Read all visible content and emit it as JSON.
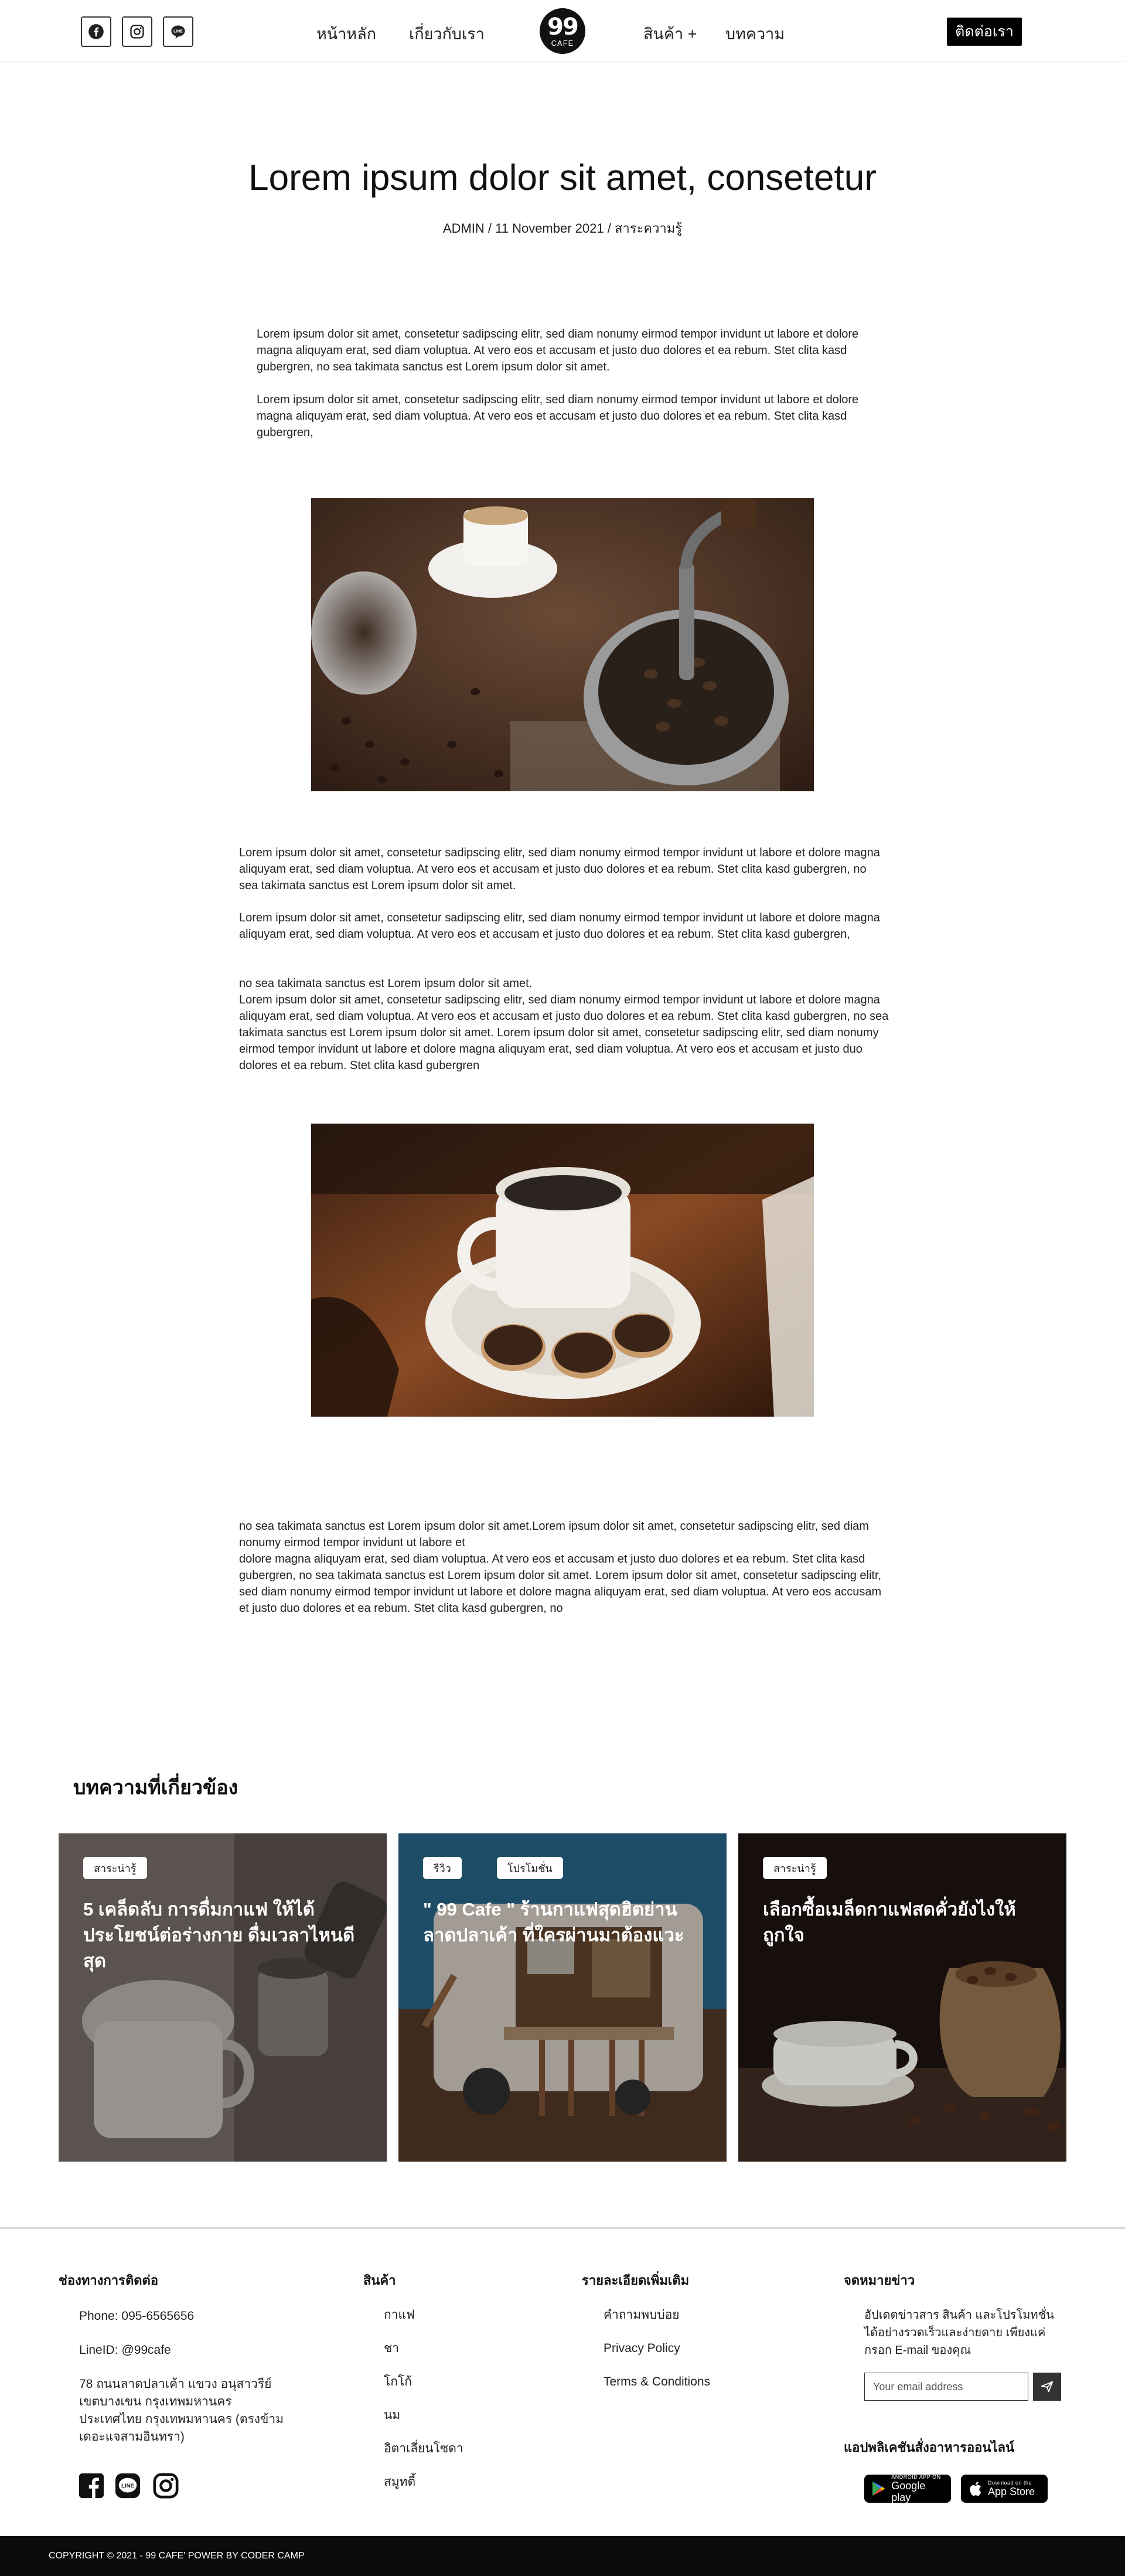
{
  "header": {
    "social": [
      {
        "name": "facebook-icon"
      },
      {
        "name": "instagram-icon"
      },
      {
        "name": "line-icon"
      }
    ],
    "nav": {
      "home": "หน้าหลัก",
      "about": "เกี่ยวกับเรา",
      "products": "สินค้า +",
      "articles": "บทความ"
    },
    "logo": {
      "number": "99",
      "word": "CAFE"
    },
    "contact_button": "ติดต่อเรา"
  },
  "article": {
    "title": "Lorem ipsum dolor sit amet, consetetur",
    "meta": "ADMIN / 11 November 2021 / สาระความรู้",
    "paragraphs_top": [
      "Lorem ipsum dolor sit amet, consetetur sadipscing elitr, sed diam nonumy eirmod tempor invidunt ut labore et dolore magna aliquyam erat, sed diam voluptua. At vero eos et accusam et justo duo dolores et ea rebum. Stet clita kasd gubergren, no sea takimata sanctus est Lorem ipsum dolor sit amet.",
      "Lorem ipsum dolor sit amet, consetetur sadipscing elitr, sed diam nonumy eirmod tempor invidunt ut labore et dolore magna aliquyam erat, sed diam voluptua. At vero eos et accusam et justo duo dolores et ea rebum. Stet clita kasd gubergren,"
    ],
    "paragraphs_mid": [
      "Lorem ipsum dolor sit amet, consetetur sadipscing elitr, sed diam nonumy eirmod tempor invidunt ut labore et dolore magna aliquyam erat, sed diam voluptua. At vero eos et accusam et justo duo dolores et ea rebum. Stet clita kasd gubergren, no sea takimata sanctus est Lorem ipsum dolor sit amet.",
      "Lorem ipsum dolor sit amet, consetetur sadipscing elitr, sed diam nonumy eirmod tempor invidunt ut labore et dolore magna aliquyam erat, sed diam voluptua. At vero eos et accusam et justo duo dolores et ea rebum. Stet clita kasd gubergren,",
      "no sea takimata sanctus est Lorem ipsum dolor sit amet.\nLorem ipsum dolor sit amet, consetetur sadipscing elitr, sed diam nonumy eirmod tempor invidunt ut labore et dolore magna aliquyam erat, sed diam voluptua. At vero eos et accusam et justo duo dolores et ea rebum. Stet clita kasd gubergren, no sea takimata sanctus est Lorem ipsum dolor sit amet. Lorem ipsum dolor sit amet, consetetur sadipscing elitr, sed diam nonumy eirmod tempor invidunt ut labore et dolore magna aliquyam erat, sed diam voluptua. At vero eos et accusam et justo duo dolores et ea rebum. Stet clita kasd gubergren"
    ],
    "paragraph_bottom": "no sea takimata sanctus est Lorem ipsum dolor sit amet.Lorem ipsum dolor sit amet, consetetur sadipscing elitr, sed diam nonumy eirmod tempor invidunt ut labore et\ndolore magna aliquyam erat, sed diam voluptua. At vero eos et accusam et justo duo dolores et ea rebum. Stet clita kasd gubergren, no sea takimata sanctus est Lorem ipsum dolor sit amet. Lorem ipsum dolor sit amet, consetetur sadipscing elitr, sed diam nonumy eirmod tempor invidunt ut labore et dolore magna aliquyam erat, sed diam voluptua. At vero eos accusam et justo duo dolores et ea rebum. Stet clita kasd gubergren, no"
  },
  "related": {
    "heading": "บทความที่เกี่ยวข้อง",
    "cards": [
      {
        "tags": [
          "สาระน่ารู้"
        ],
        "title": "5 เคล็ดลับ การดื่มกาแฟ ให้ได้ประโยชน์ต่อร่างกาย ดื่มเวลาไหนดีสุด"
      },
      {
        "tags": [
          "รีวิว",
          "โปรโมชั่น"
        ],
        "title": "\" 99 Cafe \" ร้านกาแฟสุดฮิตย่านลาดปลาเค้า ที่ใครผ่านมาต้องแวะ"
      },
      {
        "tags": [
          "สาระน่ารู้"
        ],
        "title": "เลือกซื้อเมล็ดกาแฟสดคั่วยังไงให้ถูกใจ"
      }
    ]
  },
  "footer": {
    "contact": {
      "heading": "ช่องทางการติดต่อ",
      "phone": "Phone: 095-6565656",
      "line": "LineID: @99cafe",
      "address": "78 ถนนลาดปลาเค้า แขวง อนุสาวรีย์ เขตบางเขน กรุงเทพมหานคร ประเทศไทย กรุงเทพมหานคร (ตรงข้ามเดอะแจสามอินทรา)"
    },
    "products": {
      "heading": "สินค้า",
      "items": [
        "กาแฟ",
        "ชา",
        "โกโก้",
        "นม",
        "อิตาเลี่ยนโซดา",
        "สมูทตี้"
      ]
    },
    "more": {
      "heading": "รายละเอียดเพิ่มเติม",
      "items": [
        "คำถามพบบ่อย",
        "Privacy Policy",
        "Terms & Conditions"
      ]
    },
    "newsletter": {
      "heading": "จดหมายข่าว",
      "text": "อัปเดตข่าวสาร สินค้า และโปรโมทชั่นได้อย่างรวดเร็วและง่ายดาย เพียงแค่กรอก E-mail ของคุณ",
      "placeholder": "Your email address",
      "app_heading": "แอปพลิเคชันสั่งอาหารออนไลน์",
      "google_small": "ANDROID APP ON",
      "google_big": "Google play",
      "apple_small": "Download on the",
      "apple_big": "App Store"
    },
    "copyright": "COPYRIGHT © 2021 - 99 CAFE' POWER BY CODER CAMP"
  },
  "colors": {
    "accent": "#000000",
    "footer_bg": "#0b0b0b"
  }
}
